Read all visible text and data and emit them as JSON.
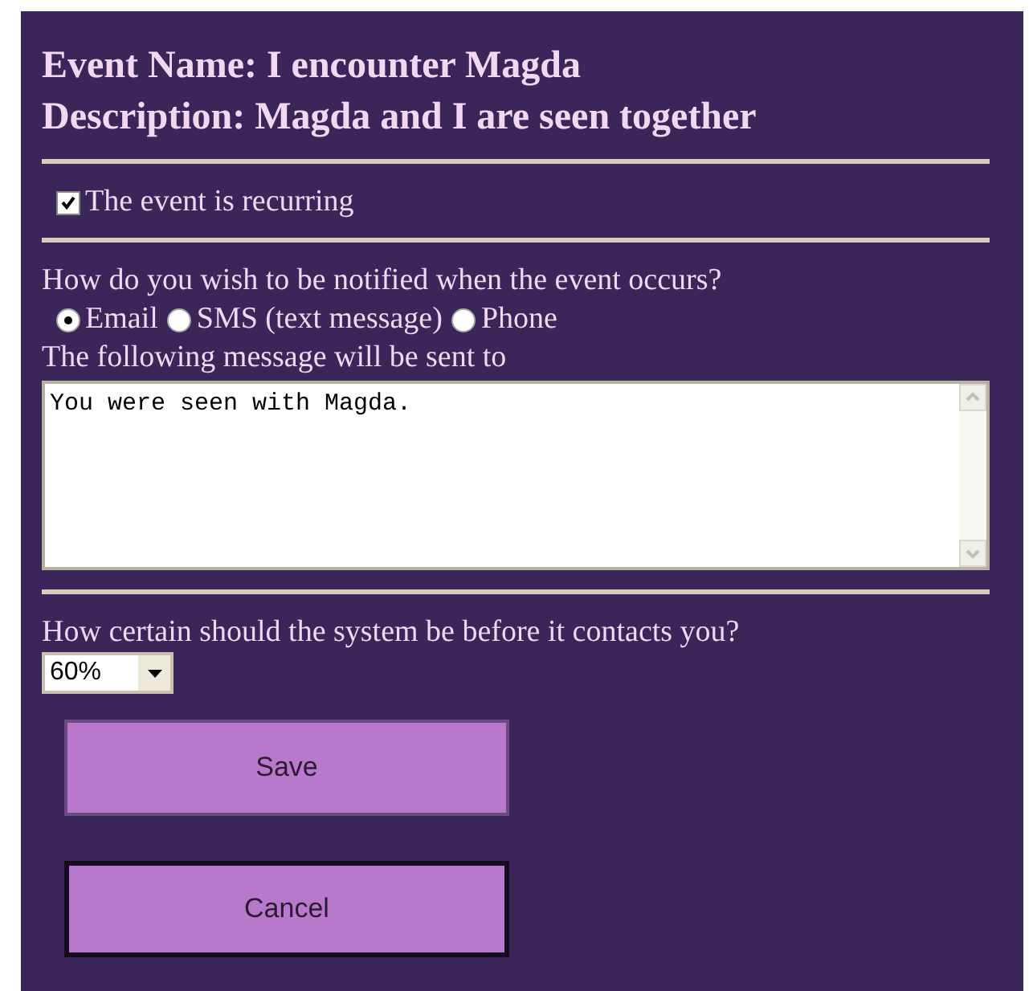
{
  "event": {
    "name_line": "Event Name: I encounter Magda",
    "description_line": "Description: Magda and I are seen together"
  },
  "recurring": {
    "label": "The event is recurring",
    "checked": true
  },
  "notify": {
    "question": "How do you wish to be notified when the event occurs?",
    "options": [
      {
        "label": "Email",
        "selected": true
      },
      {
        "label": "SMS (text message)",
        "selected": false
      },
      {
        "label": "Phone",
        "selected": false
      }
    ],
    "message_label": "The following message will be sent to",
    "message": "You were seen with Magda."
  },
  "certainty": {
    "question": "How certain should the system be before it contacts you?",
    "value": "60%"
  },
  "buttons": [
    {
      "label": "Save",
      "focused": false
    },
    {
      "label": "Cancel",
      "focused": true
    }
  ]
}
